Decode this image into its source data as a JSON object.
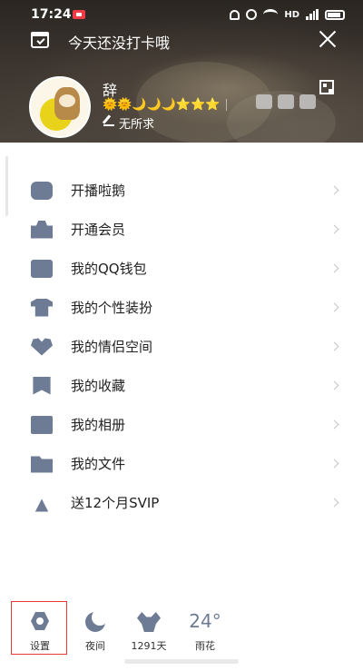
{
  "status_bar": {
    "time": "17:24",
    "network": "HD"
  },
  "checkin": {
    "text": "今天还没打卡哦"
  },
  "profile": {
    "name": "辞",
    "level_icons": "🌞🌞🌙🌙🌙⭐⭐⭐",
    "signature": "无所求"
  },
  "menu": {
    "items": [
      {
        "label": "开播啦鹅",
        "icon": "live-icon"
      },
      {
        "label": "开通会员",
        "icon": "crown-icon"
      },
      {
        "label": "我的QQ钱包",
        "icon": "wallet-icon"
      },
      {
        "label": "我的个性装扮",
        "icon": "shirt-icon"
      },
      {
        "label": "我的情侣空间",
        "icon": "heart-icon"
      },
      {
        "label": "我的收藏",
        "icon": "bookmark-icon"
      },
      {
        "label": "我的相册",
        "icon": "photo-icon"
      },
      {
        "label": "我的文件",
        "icon": "folder-icon"
      },
      {
        "label": "送12个月SVIP",
        "icon": "antenna-icon"
      }
    ]
  },
  "bottom_bar": {
    "settings": "设置",
    "night": "夜间",
    "days": "1291天",
    "weather_temp": "24°",
    "weather_city": "雨花"
  },
  "colors": {
    "icon": "#6e7b95",
    "highlight": "#e53935",
    "level": "#f5c518"
  }
}
